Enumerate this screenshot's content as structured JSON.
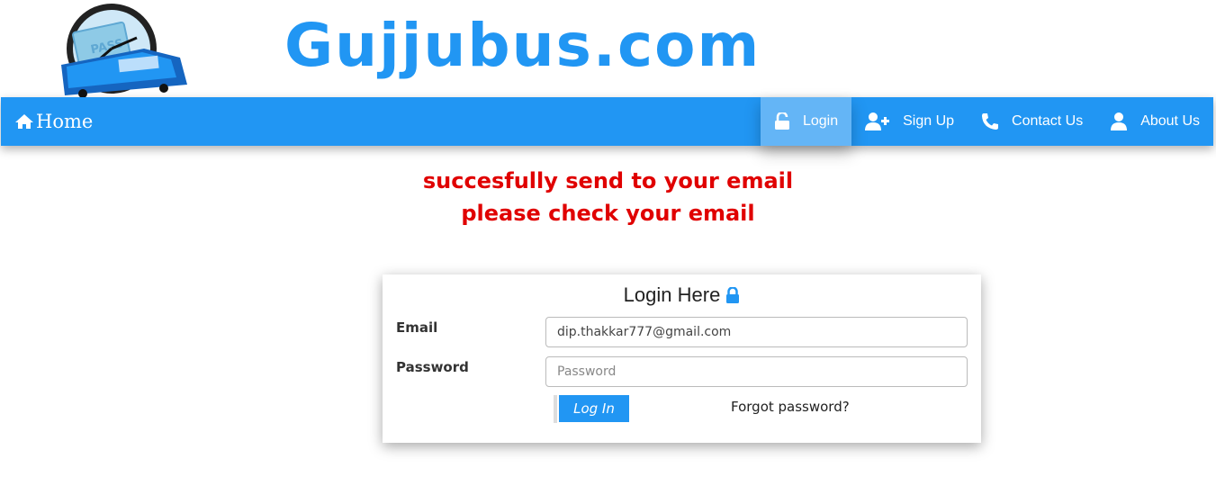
{
  "header": {
    "brand": "Gujjubus.com"
  },
  "nav": {
    "home": "Home",
    "items": [
      {
        "label": "Login",
        "icon": "unlock-icon",
        "active": true
      },
      {
        "label": "Sign Up",
        "icon": "add-user-icon",
        "active": false
      },
      {
        "label": "Contact Us",
        "icon": "phone-icon",
        "active": false
      },
      {
        "label": "About Us",
        "icon": "user-icon",
        "active": false
      }
    ]
  },
  "message": {
    "line1": "succesfully send to your email",
    "line2": "please check your email"
  },
  "login": {
    "title": "Login Here",
    "email_label": "Email",
    "email_value": "dip.thakkar777@gmail.com",
    "password_label": "Password",
    "password_placeholder": "Password",
    "submit": "Log In",
    "forgot": "Forgot password?"
  },
  "colors": {
    "accent": "#2196f3",
    "active_nav": "#64b5f6",
    "message": "#e00000"
  }
}
